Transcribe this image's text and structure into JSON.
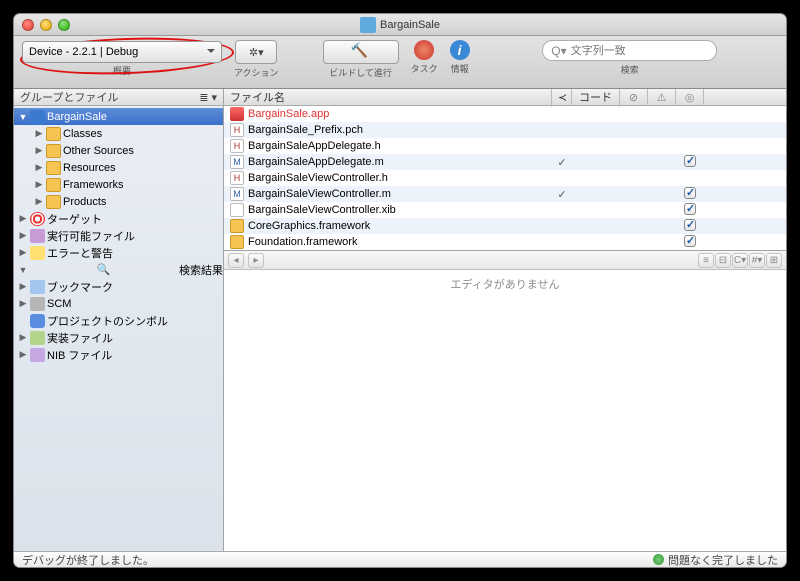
{
  "window": {
    "title": "BargainSale"
  },
  "toolbar": {
    "scheme": "Device - 2.2.1 | Debug",
    "scheme_label": "概要",
    "action_label": "アクション",
    "build_label": "ビルドして進行",
    "task_label": "タスク",
    "info_label": "情報",
    "search_placeholder": "文字列一致",
    "search_label": "検索"
  },
  "sidebar": {
    "header": "グループとファイル",
    "project": "BargainSale",
    "folders": [
      "Classes",
      "Other Sources",
      "Resources",
      "Frameworks",
      "Products"
    ],
    "items": [
      "ターゲット",
      "実行可能ファイル",
      "エラーと警告",
      "検索結果",
      "ブックマーク",
      "SCM",
      "プロジェクトのシンボル",
      "実装ファイル",
      "NIB ファイル"
    ]
  },
  "filelist": {
    "header": {
      "name": "ファイル名",
      "chk": "≺",
      "code": "コード",
      "err": "⊘",
      "warn": "⚠",
      "target": "◎"
    },
    "rows": [
      {
        "name": "BargainSale.app",
        "icon": "app",
        "red": true,
        "chk": false,
        "target": false
      },
      {
        "name": "BargainSale_Prefix.pch",
        "icon": "h",
        "chk": false,
        "target": false
      },
      {
        "name": "BargainSaleAppDelegate.h",
        "icon": "h",
        "chk": false,
        "target": false
      },
      {
        "name": "BargainSaleAppDelegate.m",
        "icon": "m",
        "chk": true,
        "target": true
      },
      {
        "name": "BargainSaleViewController.h",
        "icon": "h",
        "chk": false,
        "target": false
      },
      {
        "name": "BargainSaleViewController.m",
        "icon": "m",
        "chk": true,
        "target": true
      },
      {
        "name": "BargainSaleViewController.xib",
        "icon": "xib",
        "chk": false,
        "target": true
      },
      {
        "name": "CoreGraphics.framework",
        "icon": "fw",
        "chk": false,
        "target": true
      },
      {
        "name": "Foundation.framework",
        "icon": "fw",
        "chk": false,
        "target": true
      }
    ]
  },
  "editor": {
    "empty_msg": "エディタがありません"
  },
  "status": {
    "left": "デバッグが終了しました。",
    "right": "問題なく完了しました"
  }
}
